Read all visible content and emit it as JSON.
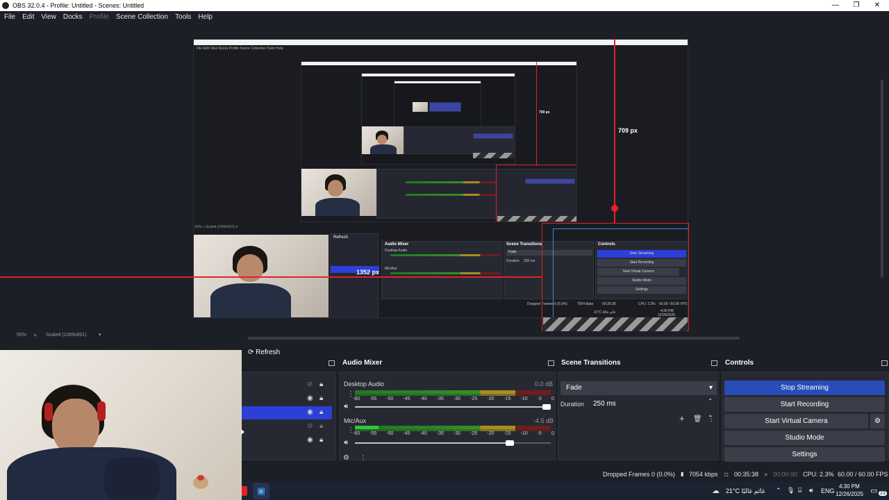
{
  "window": {
    "title": "OBS 32.0.4 - Profile: Untitled - Scenes: Untitled",
    "minimize": "—",
    "restore": "❐",
    "close": "✕"
  },
  "menu": {
    "file": "File",
    "edit": "Edit",
    "view": "View",
    "docks": "Docks",
    "profile": "Profile",
    "scene_collection": "Scene Collection",
    "tools": "Tools",
    "help": "Help"
  },
  "preview": {
    "measure_vertical": "709 px",
    "measure_horizontal": "1352 px",
    "zoom": "55%",
    "scale_info": "Scaled (1069x601)",
    "nested_refresh": "Refresh",
    "nested_audio_mixer": "Audio Mixer",
    "nested_scene_transitions": "Scene Transitions",
    "nested_controls": "Controls",
    "nested_desktop_audio": "Desktop Audio",
    "nested_mic_aux": "Mic/Aux",
    "nested_fade": "Fade",
    "nested_duration": "Duration",
    "nested_duration_val": "250 ms",
    "nested_stop_streaming": "Stop Streaming",
    "nested_start_recording": "Start Recording",
    "nested_start_virtual_camera": "Start Virtual Camera",
    "nested_studio_mode": "Studio Mode",
    "nested_settings": "Settings",
    "nested_dropped": "Dropped Frames 0 (0.0%)",
    "nested_kbps": "7054 kbps",
    "nested_time": "00:35:38",
    "nested_cpu": "CPU: 2.3%",
    "nested_fps": "60.00 / 60.00 FPS",
    "nested_weather": "21°C غائم غالبًا",
    "nested_clock": "4:30 PM",
    "nested_date": "12/26/2025",
    "mini_709": "709 px"
  },
  "sources": {
    "refresh_label": "Refresh"
  },
  "audio_mixer": {
    "title": "Audio Mixer",
    "channels": [
      {
        "name": "Desktop Audio",
        "db": "0.0 dB",
        "volume": 0.98
      },
      {
        "name": "Mic/Aux",
        "db": "-4.5 dB",
        "volume": 0.79
      }
    ],
    "ticks": [
      "-60",
      "-55",
      "-50",
      "-45",
      "-40",
      "-35",
      "-30",
      "-25",
      "-20",
      "-15",
      "-10",
      "-5",
      "0"
    ]
  },
  "transitions": {
    "title": "Scene Transitions",
    "selected": "Fade",
    "duration_label": "Duration",
    "duration_value": "250 ms"
  },
  "controls": {
    "title": "Controls",
    "stop_streaming": "Stop Streaming",
    "start_recording": "Start Recording",
    "start_virtual_camera": "Start Virtual Camera",
    "studio_mode": "Studio Mode",
    "settings": "Settings"
  },
  "status": {
    "dropped": "Dropped Frames 0 (0.0%)",
    "kbps": "7054 kbps",
    "live_time": "00:35:38",
    "rec_time": "00:00:00",
    "cpu": "CPU: 2.3%",
    "fps": "60.00 / 60.00 FPS"
  },
  "taskbar": {
    "weather": "21°C  غائم غالبًا",
    "language": "ENG",
    "time": "4:30 PM",
    "date": "12/26/2025",
    "notifications": "23"
  },
  "colors": {
    "accent": "#284cb8",
    "selection": "#2c3fd6",
    "red_guide": "#e0222b",
    "background": "#1d1f26",
    "panel": "#272932"
  }
}
